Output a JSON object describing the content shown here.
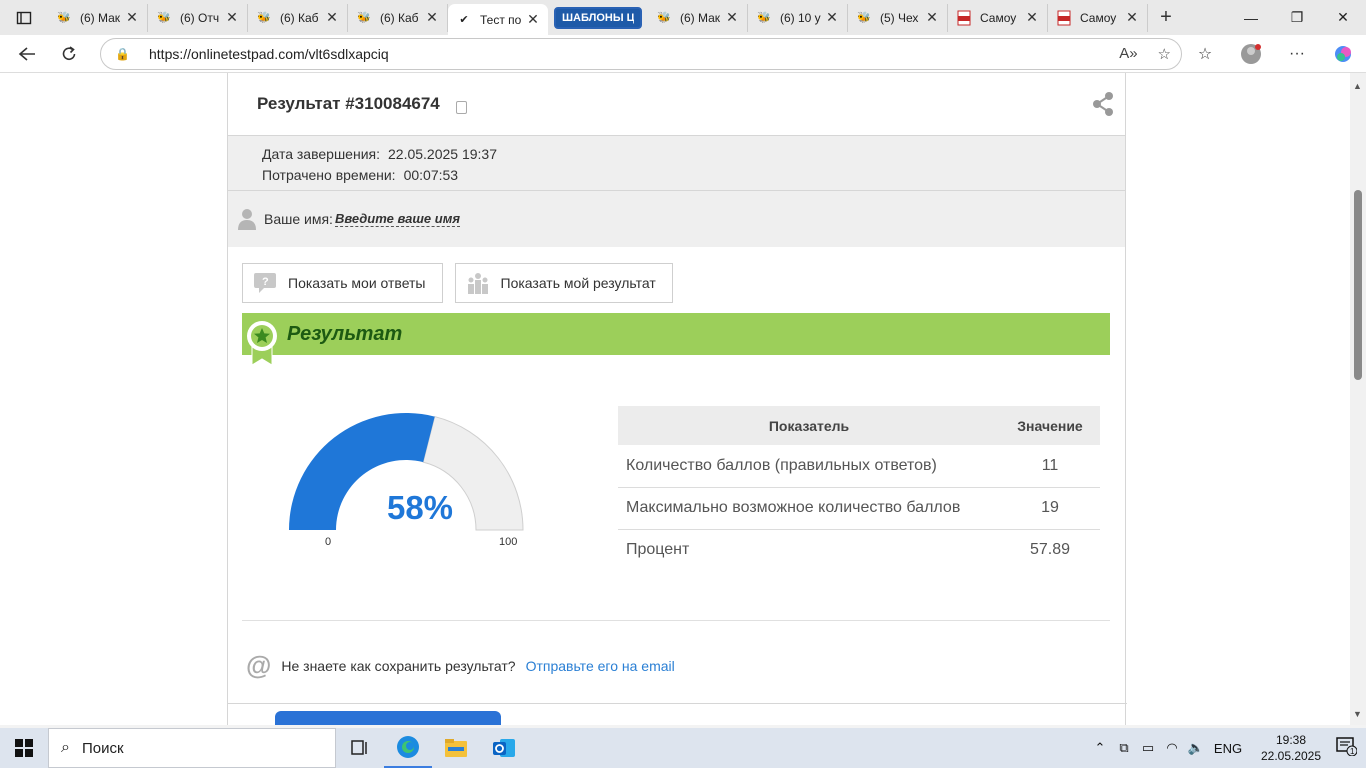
{
  "browser": {
    "tabs": [
      {
        "title": "(6) Мак",
        "icon": "bee-icon",
        "active": false
      },
      {
        "title": "(6) Отч",
        "icon": "bee-icon",
        "active": false
      },
      {
        "title": "(6) Каб",
        "icon": "bee-icon",
        "active": false
      },
      {
        "title": "(6) Каб",
        "icon": "bee-icon",
        "active": false
      },
      {
        "title": "Тест по",
        "icon": "check-icon",
        "active": true
      }
    ],
    "group_label": "ШАБЛОНЫ Ц",
    "tabs2": [
      {
        "title": "(6) Мак",
        "icon": "bee-icon"
      },
      {
        "title": "(6) 10 у",
        "icon": "bee-icon"
      },
      {
        "title": "(5) Чех",
        "icon": "bee-icon"
      },
      {
        "title": "Самоу",
        "icon": "pdf-icon"
      },
      {
        "title": "Самоу",
        "icon": "pdf-icon"
      }
    ],
    "url": "https://onlinetestpad.com/vlt6sdlxapciq"
  },
  "result": {
    "title": "Результат #310084674",
    "date_label": "Дата завершения:",
    "date_value": "22.05.2025 19:37",
    "time_label": "Потрачено времени:",
    "time_value": "00:07:53",
    "name_label": "Ваше имя:",
    "name_link": "Введите ваше имя",
    "show_answers": "Показать мои ответы",
    "show_result": "Показать мой результат",
    "section_title": "Результат",
    "gauge": {
      "percent_text": "58%",
      "value": 57.89,
      "min_label": "0",
      "max_label": "100",
      "fill_color": "#1f77d8",
      "track_color": "#efefef"
    },
    "table": {
      "headers": [
        "Показатель",
        "Значение"
      ],
      "rows": [
        [
          "Количество баллов (правильных ответов)",
          "11"
        ],
        [
          "Максимально возможное количество баллов",
          "19"
        ],
        [
          "Процент",
          "57.89"
        ]
      ]
    },
    "email_question": "Не знаете как сохранить результат?",
    "email_link": "Отправьте его на email"
  },
  "taskbar": {
    "search_placeholder": "Поиск",
    "lang": "ENG",
    "time": "19:38",
    "date": "22.05.2025",
    "notifications": "1"
  }
}
